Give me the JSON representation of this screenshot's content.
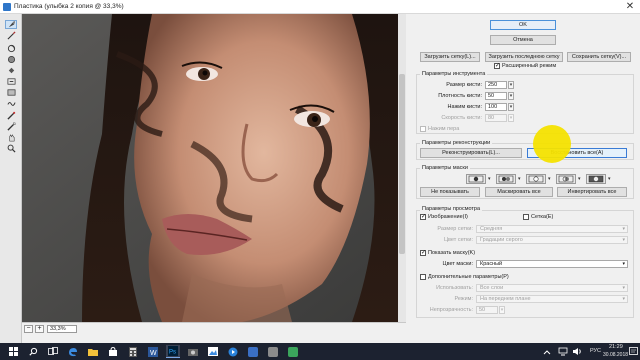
{
  "window": {
    "title": "Пластика (улыбка 2 копия @ 33,3%)",
    "close": "✕"
  },
  "tools": [
    {
      "name": "forward-warp-tool-icon",
      "active": true
    },
    {
      "name": "reconstruct-tool-icon"
    },
    {
      "name": "twirl-tool-icon"
    },
    {
      "name": "pucker-tool-icon"
    },
    {
      "name": "bloat-tool-icon"
    },
    {
      "name": "push-left-tool-icon"
    },
    {
      "name": "mirror-tool-icon"
    },
    {
      "name": "turbulence-tool-icon"
    },
    {
      "name": "freeze-mask-tool-icon"
    },
    {
      "name": "thaw-mask-tool-icon"
    },
    {
      "name": "hand-tool-icon"
    },
    {
      "name": "zoom-tool-icon"
    }
  ],
  "statusbar": {
    "zoom_minus": "−",
    "zoom_plus": "+",
    "zoom": "33,3%"
  },
  "panel": {
    "ok": "OK",
    "cancel": "Отмена",
    "load_mesh": "Загрузить сетку(L)...",
    "load_last_mesh": "Загрузить последнюю сетку",
    "save_mesh": "Сохранить сетку(V)...",
    "advanced_mode": "Расширенный режим",
    "tool_options": {
      "title": "Параметры инструмента",
      "brush_size_label": "Размер кисти:",
      "brush_size": "250",
      "brush_density_label": "Плотность кисти:",
      "brush_density": "50",
      "brush_pressure_label": "Нажим кисти:",
      "brush_pressure": "100",
      "brush_rate_label": "Скорость кисти:",
      "brush_rate": "80",
      "stylus_pressure": "Нажим пера"
    },
    "reconstruct": {
      "title": "Параметры реконструкции",
      "reconstruct_btn": "Реконструировать(L)...",
      "restore_all_btn": "Восстановить все(A)"
    },
    "mask": {
      "title": "Параметры маски",
      "none_btn": "Не показывать",
      "mask_all_btn": "Маскировать все",
      "invert_all_btn": "Инвертировать все"
    },
    "view": {
      "title": "Параметры просмотра",
      "show_image": "Изображение(I)",
      "show_mesh": "Сетка(E)",
      "mesh_size_label": "Размер сетки:",
      "mesh_size": "Средняя",
      "mesh_color_label": "Цвет сетки:",
      "mesh_color": "Градации серого",
      "show_mask": "Показать маску(K)",
      "mask_color_label": "Цвет маски:",
      "mask_color": "Красный",
      "show_backdrop": "Дополнительные параметры(P)",
      "use_label": "Использовать:",
      "use": "Все слои",
      "mode_label": "Режим:",
      "mode": "На переднем плане",
      "opacity_label": "Непрозрачность:",
      "opacity": "50"
    }
  },
  "taskbar": {
    "apps": [
      {
        "name": "windows-start-icon"
      },
      {
        "name": "search-icon"
      },
      {
        "name": "task-view-icon"
      },
      {
        "name": "edge-browser-icon"
      },
      {
        "name": "file-explorer-icon"
      },
      {
        "name": "store-icon"
      },
      {
        "name": "calculator-icon"
      },
      {
        "name": "word-icon"
      },
      {
        "name": "photoshop-icon",
        "active": true
      },
      {
        "name": "camera-app-icon"
      },
      {
        "name": "photos-app-icon"
      },
      {
        "name": "media-player-icon"
      },
      {
        "name": "app-icon-blue"
      },
      {
        "name": "app-icon-gray"
      },
      {
        "name": "app-icon-green"
      }
    ],
    "lang": "РУС",
    "time": "21:29",
    "date": "30.08.2018"
  },
  "colors": {
    "canvas_bg": "#4a4a48",
    "accent": "#3a7bd5",
    "taskbar": "#1c2230",
    "highlight": "#f4e200"
  }
}
